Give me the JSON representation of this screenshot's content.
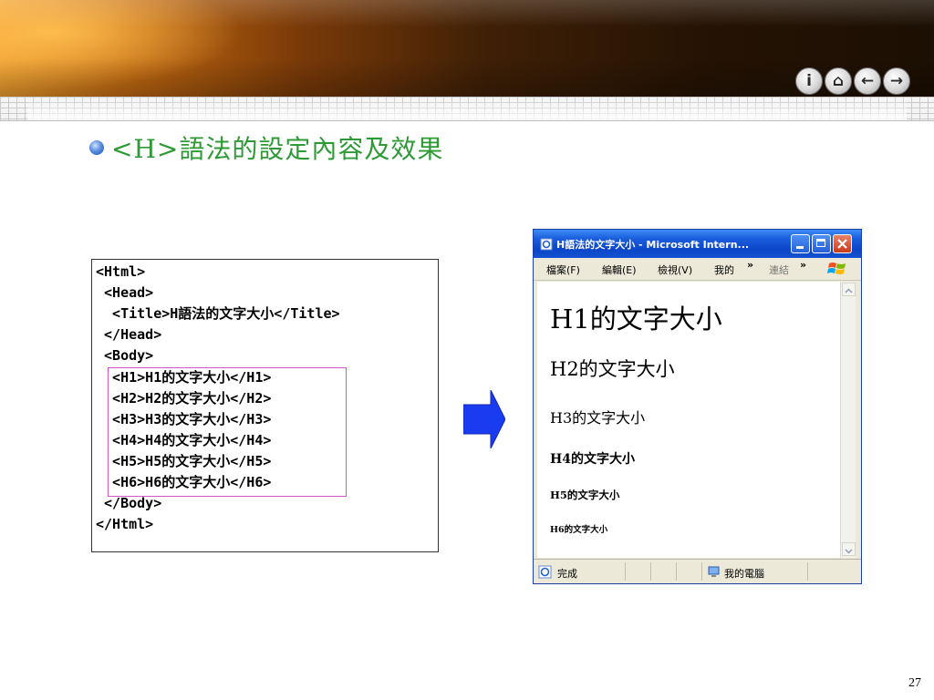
{
  "slide": {
    "heading": "<H>語法的設定內容及效果",
    "page_number": "27"
  },
  "nav_buttons": [
    {
      "icon": "info-icon",
      "glyph": "i"
    },
    {
      "icon": "home-icon",
      "glyph": "⌂"
    },
    {
      "icon": "back-arrow-icon",
      "glyph": "←"
    },
    {
      "icon": "forward-arrow-icon",
      "glyph": "→"
    }
  ],
  "code_lines": [
    "<Html>",
    " <Head>",
    "  <Title>H語法的文字大小</Title>",
    " </Head>",
    " <Body>",
    "  <H1>H1的文字大小</H1>",
    "  <H2>H2的文字大小</H2>",
    "  <H3>H3的文字大小</H3>",
    "  <H4>H4的文字大小</H4>",
    "  <H5>H5的文字大小</H5>",
    "  <H6>H6的文字大小</H6>",
    " </Body>",
    "</Html>"
  ],
  "browser": {
    "title": "H語法的文字大小 - Microsoft Intern...",
    "menu": {
      "file": "檔案(F)",
      "edit": "編輯(E)",
      "view": "檢視(V)",
      "favorites": "我的",
      "chevron1": "»",
      "links": "連結",
      "chevron2": "»"
    },
    "headings": {
      "h1": "H1的文字大小",
      "h2": "H2的文字大小",
      "h3": "H3的文字大小",
      "h4": "H4的文字大小",
      "h5": "H5的文字大小",
      "h6": "H6的文字大小"
    },
    "status": {
      "done": "完成",
      "zone": "我的電腦"
    }
  },
  "colors": {
    "heading_text": "#2e9a36",
    "highlight_border": "#d254c8",
    "arrow": "#1a3cf0",
    "titlebar": "#0b46c8"
  }
}
